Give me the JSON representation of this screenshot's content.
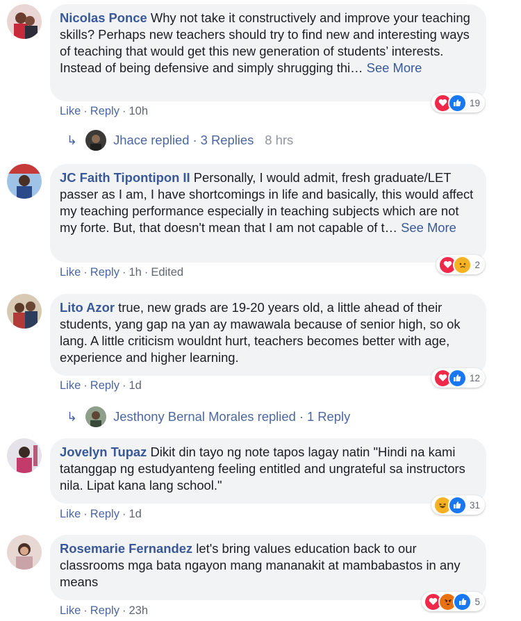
{
  "labels": {
    "like": "Like",
    "reply": "Reply",
    "separator": "·"
  },
  "comments": [
    {
      "author": "Nicolas Ponce",
      "text": "Why not take it constructively and improve your teaching skills? Perhaps new teachers should try to find new and interesting ways of teaching that would get this new generation of students’ interests. Instead of being defensive and simply shrugging thi…",
      "see_more": "See More",
      "time": "10h",
      "edited": "",
      "reactions": [
        "love",
        "like"
      ],
      "reaction_count": "19",
      "replies": {
        "name": "Jhace replied",
        "count": "3 Replies",
        "time": "8 hrs"
      }
    },
    {
      "author": "JC Faith Tipontipon II",
      "text": "Personally, I would admit, fresh graduate/LET passer as I am, I have shortcomings in life and basically, this would affect my teaching performance especially in teaching subjects which are not my forte. But, that doesn't mean that I am not capable of t…",
      "see_more": "See More",
      "time": "1h",
      "edited": "Edited",
      "reactions": [
        "love",
        "sad"
      ],
      "reaction_count": "2"
    },
    {
      "author": "Lito Azor",
      "text": "true, new grads are 19-20 years old, a little ahead of their students, yang gap na yan ay mawawala because of senior high, so ok lang. A little criticism wouldnt hurt, teachers becomes better with age, experience and higher learning.",
      "see_more": "",
      "time": "1d",
      "edited": "",
      "reactions": [
        "love",
        "like"
      ],
      "reaction_count": "12",
      "replies": {
        "name": "Jesthony Bernal Morales replied",
        "count": "1 Reply",
        "time": ""
      }
    },
    {
      "author": "Jovelyn Tupaz",
      "text": "Dikit din tayo ng note tapos lagay natin \"Hindi na kami tatanggap ng estudyanteng feeling entitled and ungrateful sa instructors nila. Lipat kana lang school.\"",
      "see_more": "",
      "time": "1d",
      "edited": "",
      "reactions": [
        "haha",
        "like"
      ],
      "reaction_count": "31"
    },
    {
      "author": "Rosemarie Fernandez",
      "text": "let's bring values education back to our classrooms mga bata ngayon mang mananakit at mambabastos in any means",
      "see_more": "",
      "time": "23h",
      "edited": "",
      "reactions": [
        "love",
        "angry",
        "like"
      ],
      "reaction_count": "5"
    }
  ],
  "colors": {
    "link": "#385898",
    "bubble": "#f2f3f5",
    "meta": "#606770",
    "love": "#f0284a",
    "like": "#1877f2"
  }
}
